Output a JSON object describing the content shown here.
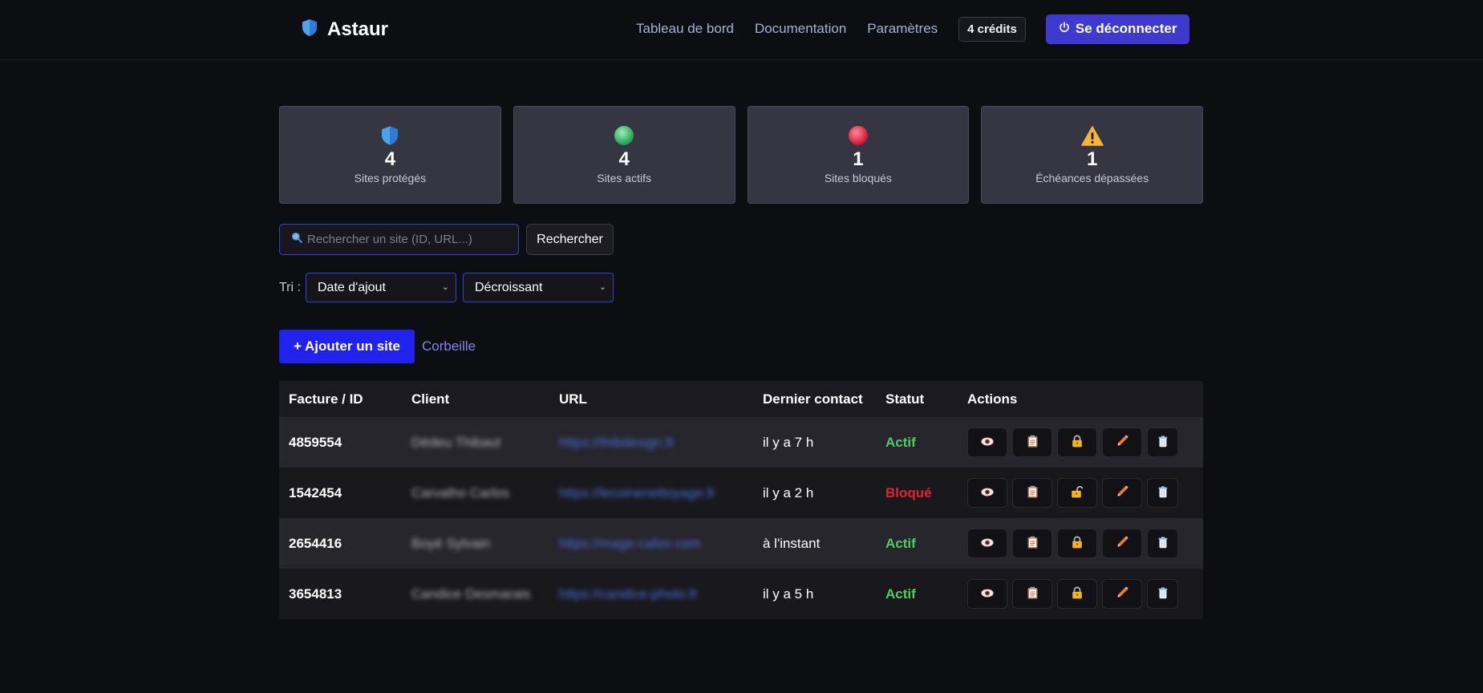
{
  "header": {
    "brand": "Astaur",
    "nav": [
      "Tableau de bord",
      "Documentation",
      "Paramètres"
    ],
    "credits": "4 crédits",
    "logout_label": "Se déconnecter"
  },
  "stats": [
    {
      "icon": "shield-icon",
      "value": "4",
      "label": "Sites protégés"
    },
    {
      "icon": "green-dot-icon",
      "value": "4",
      "label": "Sites actifs"
    },
    {
      "icon": "red-dot-icon",
      "value": "1",
      "label": "Sites bloqués"
    },
    {
      "icon": "warning-icon",
      "value": "1",
      "label": "Échéances dépassées"
    }
  ],
  "search": {
    "placeholder": "Rechercher un site (ID, URL...)",
    "button_label": "Rechercher"
  },
  "sort": {
    "label": "Tri :",
    "field": "Date d'ajout",
    "order": "Décroissant"
  },
  "actions_bar": {
    "add_label": "+ Ajouter un site",
    "trash_label": "Corbeille"
  },
  "table": {
    "headers": [
      "Facture / ID",
      "Client",
      "URL",
      "Dernier contact",
      "Statut",
      "Actions"
    ],
    "rows": [
      {
        "id": "4859554",
        "client": "Dédeu Thibaut",
        "url": "https://thibdesign.fr",
        "contact": "il y a 7 h",
        "status": "Actif",
        "lock": "locked"
      },
      {
        "id": "1542454",
        "client": "Carvalho Carlos",
        "url": "https://lecoinenettoyage.fr",
        "contact": "il y a 2 h",
        "status": "Bloqué",
        "lock": "unlocked"
      },
      {
        "id": "2654416",
        "client": "Boyé Sylvain",
        "url": "https://mage-cafes.com",
        "contact": "à l'instant",
        "status": "Actif",
        "lock": "locked"
      },
      {
        "id": "3654813",
        "client": "Candice Desmarais",
        "url": "https://candice-photo.fr",
        "contact": "il y a 5 h",
        "status": "Actif",
        "lock": "locked"
      }
    ]
  },
  "colors": {
    "accent": "#3e3ad0",
    "active": "#4ccd62",
    "blocked": "#e2242c"
  }
}
